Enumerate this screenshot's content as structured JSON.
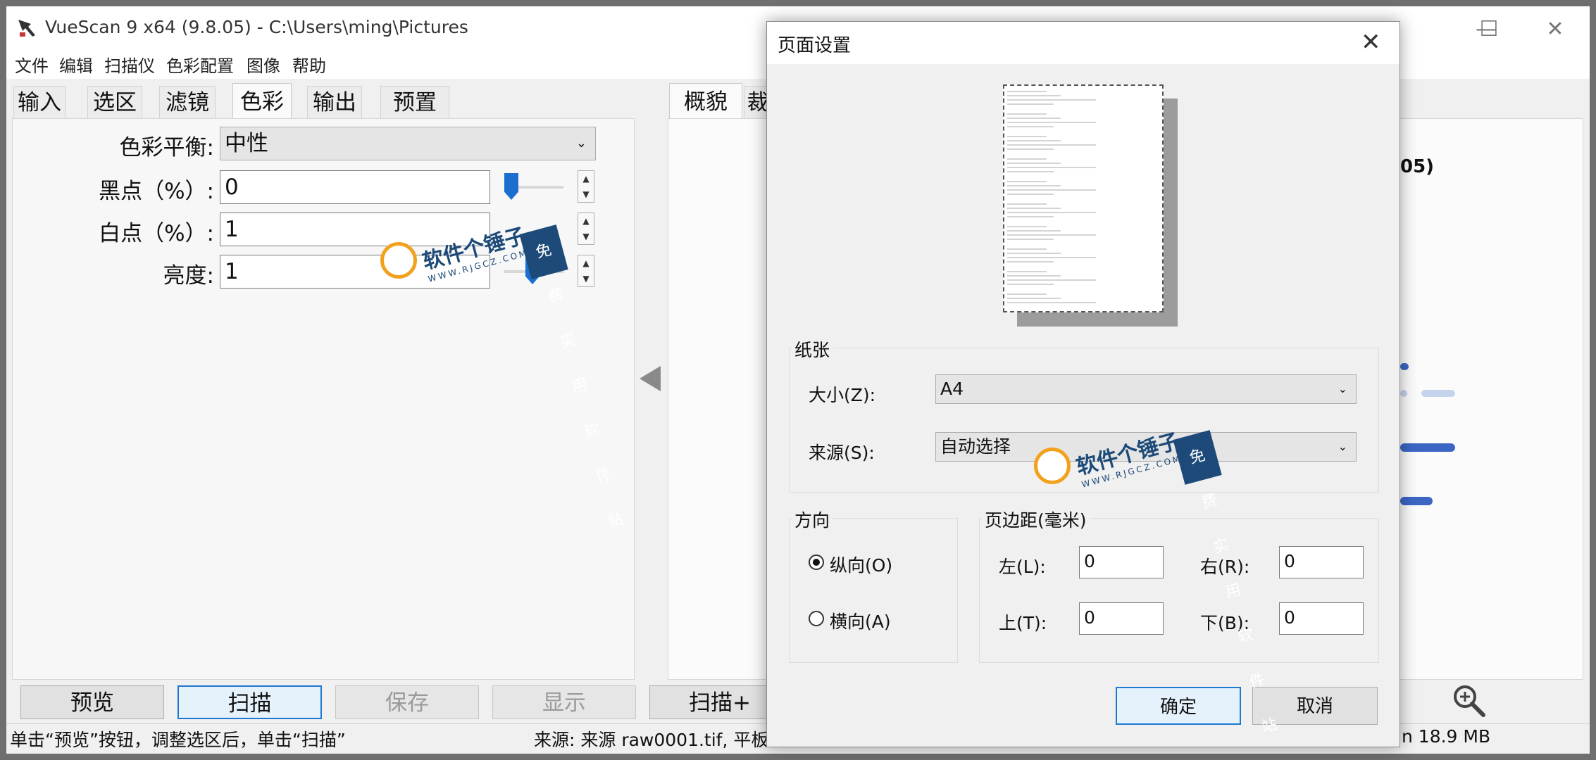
{
  "window": {
    "title": "VueScan 9 x64 (9.8.05) - C:\\Users\\ming\\Pictures",
    "minimize_icon": "minimize-icon",
    "maximize_icon": "maximize-icon",
    "close_icon": "close-icon"
  },
  "menu": [
    "文件",
    "编辑",
    "扫描仪",
    "色彩配置",
    "图像",
    "帮助"
  ],
  "left_tabs": [
    {
      "label": "输入",
      "active": false
    },
    {
      "label": "选区",
      "active": false
    },
    {
      "label": "滤镜",
      "active": false
    },
    {
      "label": "色彩",
      "active": true
    },
    {
      "label": "输出",
      "active": false
    },
    {
      "label": "预置",
      "active": false
    }
  ],
  "color_settings": {
    "color_balance": {
      "label": "色彩平衡:",
      "value": "中性"
    },
    "black_point": {
      "label": "黑点（%）:",
      "value": "0",
      "slider_level": 0
    },
    "white_point": {
      "label": "白点（%）:",
      "value": "1"
    },
    "brightness": {
      "label": "亮度:",
      "value": "1",
      "slider_level": 0.5
    }
  },
  "right_tabs": [
    {
      "label": "概貌",
      "active": true
    },
    {
      "label": "裁",
      "active": false
    }
  ],
  "right_pane": {
    "partial_text": "05)",
    "collapse_icon": "triangle-left-icon"
  },
  "buttons": {
    "preview": "预览",
    "scan": "扫描",
    "save": "保存",
    "show": "显示",
    "scan_plus": "扫描+",
    "zoom_icon": "zoom-in-icon"
  },
  "status": {
    "hint": "单击“预览”按钮，调整选区后，单击“扫描”",
    "source": "来源: 来源 raw0001.tif, 平板",
    "memory": "n 18.9 MB"
  },
  "dialog": {
    "title": "页面设置",
    "close_icon": "close-icon",
    "paper": {
      "label": "纸张",
      "size_label": "大小(Z):",
      "size_value": "A4",
      "source_label": "来源(S):",
      "source_value": "自动选择"
    },
    "orientation": {
      "label": "方向",
      "portrait": "纵向(O)",
      "landscape": "横向(A)",
      "selected": "portrait"
    },
    "margins": {
      "label": "页边距(毫米)",
      "left_label": "左(L):",
      "left_value": "0",
      "right_label": "右(R):",
      "right_value": "0",
      "top_label": "上(T):",
      "top_value": "0",
      "bottom_label": "下(B):",
      "bottom_value": "0"
    },
    "ok": "确定",
    "cancel": "取消"
  },
  "watermark": {
    "name": "软件个锤子",
    "slogan": "免费实用软件站",
    "url": "WWW.RJGCZ.COM"
  },
  "colors": {
    "accent": "#1a6fcf",
    "watermark_blue": "#1d4a78",
    "watermark_orange": "#f2a11d"
  }
}
